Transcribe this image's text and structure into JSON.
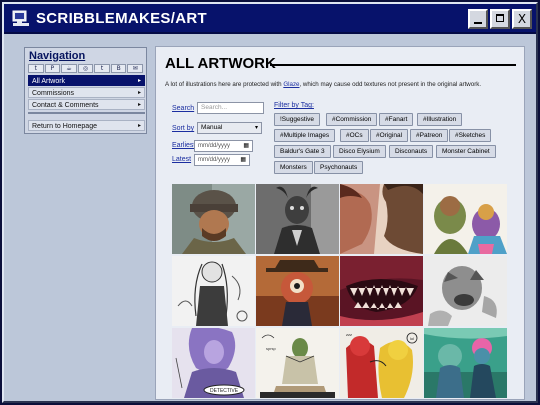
{
  "window": {
    "title": "SCRIBBLEMAKES/ART",
    "buttons": {
      "minimize": "minimize",
      "maximize": "maximize",
      "close": "X"
    }
  },
  "sidebar": {
    "heading": "Navigation",
    "social_icons": [
      "tumblr-icon",
      "patreon-icon",
      "kofi-icon",
      "instagram-icon",
      "twitter-icon",
      "bluesky-icon",
      "mail-icon"
    ],
    "social_glyphs": [
      "t",
      "P",
      "☕",
      "◎",
      "t",
      "B",
      "✉"
    ],
    "items": [
      {
        "label": "All Artwork",
        "active": true
      },
      {
        "label": "Commissions",
        "active": false
      },
      {
        "label": "Contact & Comments",
        "active": false
      }
    ],
    "return_label": "Return to Homepage",
    "arrow": "▸"
  },
  "main": {
    "title": "ALL ARTWORK",
    "notice_pre": "A lot of illustrations here are protected with ",
    "notice_link": "Glaze",
    "notice_post": ", which may cause odd textures not present in the original artwork.",
    "search": {
      "label": "Search",
      "placeholder": "Search..."
    },
    "sort": {
      "label": "Sort by",
      "value": "Manual"
    },
    "earliest": {
      "label": "Earliest",
      "value": "mm/dd/yyyy"
    },
    "latest": {
      "label": "Latest",
      "value": "mm/dd/yyyy"
    },
    "filter_label": "Filter by Tag:",
    "tags": [
      "!Suggestive",
      "#Commission",
      "#Fanart",
      "#Illustration",
      "#Multiple Images",
      "#OCs",
      "#Original",
      "#Patreon",
      "#Sketches",
      "Baldur's Gate 3",
      "Disco Elysium",
      "Disconauts",
      "Monster Cabinet",
      "Monsters",
      "Psychonauts"
    ],
    "gallery_items": [
      "artwork-thumbnail-1",
      "artwork-thumbnail-2",
      "artwork-thumbnail-3",
      "artwork-thumbnail-4",
      "artwork-thumbnail-5",
      "artwork-thumbnail-6",
      "artwork-thumbnail-7",
      "artwork-thumbnail-8",
      "artwork-thumbnail-9",
      "artwork-thumbnail-10",
      "artwork-thumbnail-11",
      "artwork-thumbnail-12"
    ],
    "sketch_texts": {
      "detective": "DETECTIVE",
      "spray": "sprsp",
      "zzz": "zzz",
      "blob": "lol"
    }
  },
  "colors": {
    "titlebar": "#07126b",
    "desktop": "#0b0f3a",
    "window": "#bcc7d9",
    "link": "#1b2ea0"
  }
}
